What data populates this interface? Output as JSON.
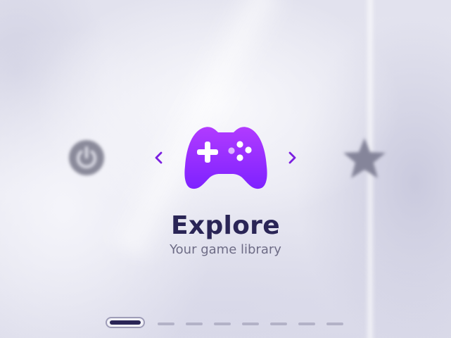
{
  "menu": {
    "current": {
      "title": "Explore",
      "subtitle": "Your game library",
      "icon": "gamepad-icon"
    },
    "previous_icon": "power-icon",
    "next_icon": "star-icon",
    "nav_prev_icon": "chevron-left-icon",
    "nav_next_icon": "chevron-right-icon"
  },
  "pager": {
    "count": 8,
    "active_index": 0
  },
  "colors": {
    "accent_top": "#b13bff",
    "accent_bottom": "#7e22ff",
    "title": "#2a2556",
    "subtitle": "#6e6c86",
    "arrow": "#7b1fe0",
    "side_icon": "#888899"
  }
}
